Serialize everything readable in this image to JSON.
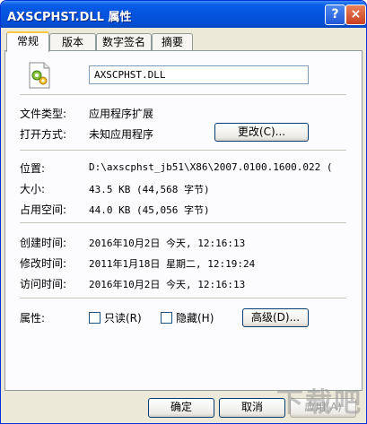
{
  "window": {
    "title": "AXSCPHST.DLL 属性",
    "help_glyph": "?",
    "close_glyph": "×"
  },
  "tabs": [
    {
      "label": "常规"
    },
    {
      "label": "版本"
    },
    {
      "label": "数字签名"
    },
    {
      "label": "摘要"
    }
  ],
  "general": {
    "file_name": "AXSCPHST.DLL",
    "type_label": "文件类型:",
    "type_value": "应用程序扩展",
    "open_label": "打开方式:",
    "open_value": "未知应用程序",
    "change_button": "更改(C)...",
    "location_label": "位置:",
    "location_value": "D:\\axscphst_jb51\\X86\\2007.0100.1600.022 (",
    "size_label": "大小:",
    "size_value": "43.5 KB (44,568 字节)",
    "disk_label": "占用空间:",
    "disk_value": "44.0 KB (45,056 字节)",
    "created_label": "创建时间:",
    "created_value": "2016年10月2日 今天, 12:16:13",
    "modified_label": "修改时间:",
    "modified_value": "2011年1月18日 星期二, 12:19:24",
    "accessed_label": "访问时间:",
    "accessed_value": "2016年10月2日 今天, 12:16:13",
    "attr_label": "属性:",
    "readonly_label": "只读(R)",
    "readonly_checked": false,
    "hidden_label": "隐藏(H)",
    "hidden_checked": false,
    "advanced_button": "高级(D)..."
  },
  "footer": {
    "ok": "确定",
    "cancel": "取消",
    "apply": "应用(A)"
  },
  "watermark": "下载吧"
}
